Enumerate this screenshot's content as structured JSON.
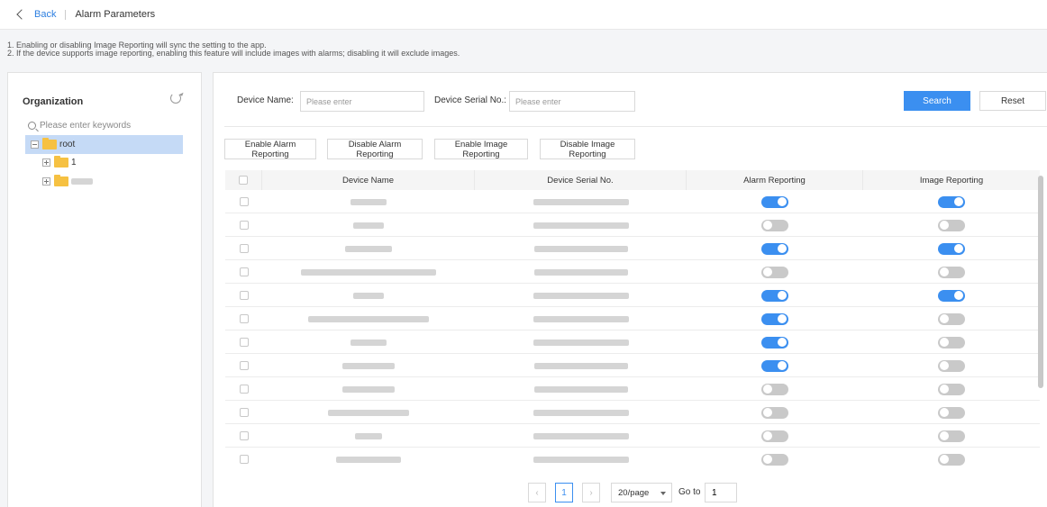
{
  "header": {
    "back_label": "Back",
    "title": "Alarm Parameters"
  },
  "notes": [
    "1. Enabling or disabling Image Reporting will sync the setting to the app.",
    "2. If the device supports image reporting, enabling this feature will include images with alarms; disabling it will exclude images."
  ],
  "sidebar": {
    "title": "Organization",
    "search_placeholder": "Please enter keywords",
    "tree": {
      "root": "root",
      "children": [
        "1",
        ""
      ]
    }
  },
  "filters": {
    "device_name_label": "Device Name:",
    "device_name_placeholder": "Please enter",
    "serial_label": "Device Serial No.:",
    "serial_placeholder": "Please enter",
    "search_label": "Search",
    "reset_label": "Reset"
  },
  "actions": {
    "enable_alarm": "Enable Alarm Reporting",
    "disable_alarm": "Disable Alarm Reporting",
    "enable_image": "Enable Image Reporting",
    "disable_image": "Disable Image Reporting"
  },
  "table": {
    "columns": [
      "Device Name",
      "Device Serial No.",
      "Alarm Reporting",
      "Image Reporting"
    ],
    "rows": [
      {
        "alarm": true,
        "image": true
      },
      {
        "alarm": false,
        "image": false
      },
      {
        "alarm": true,
        "image": true
      },
      {
        "alarm": false,
        "image": false
      },
      {
        "alarm": true,
        "image": true
      },
      {
        "alarm": true,
        "image": false
      },
      {
        "alarm": true,
        "image": false
      },
      {
        "alarm": true,
        "image": false
      },
      {
        "alarm": false,
        "image": false
      },
      {
        "alarm": false,
        "image": false
      },
      {
        "alarm": false,
        "image": false
      },
      {
        "alarm": false,
        "image": false
      }
    ]
  },
  "pagination": {
    "prev": "‹",
    "current_page": "1",
    "next": "›",
    "page_size": "20/page",
    "goto_label": "Go to",
    "goto_value": "1"
  },
  "colors": {
    "accent": "#3b8ff0",
    "toggle_off": "#c9c9c9",
    "selected_tree_bg": "#c5daf6"
  }
}
